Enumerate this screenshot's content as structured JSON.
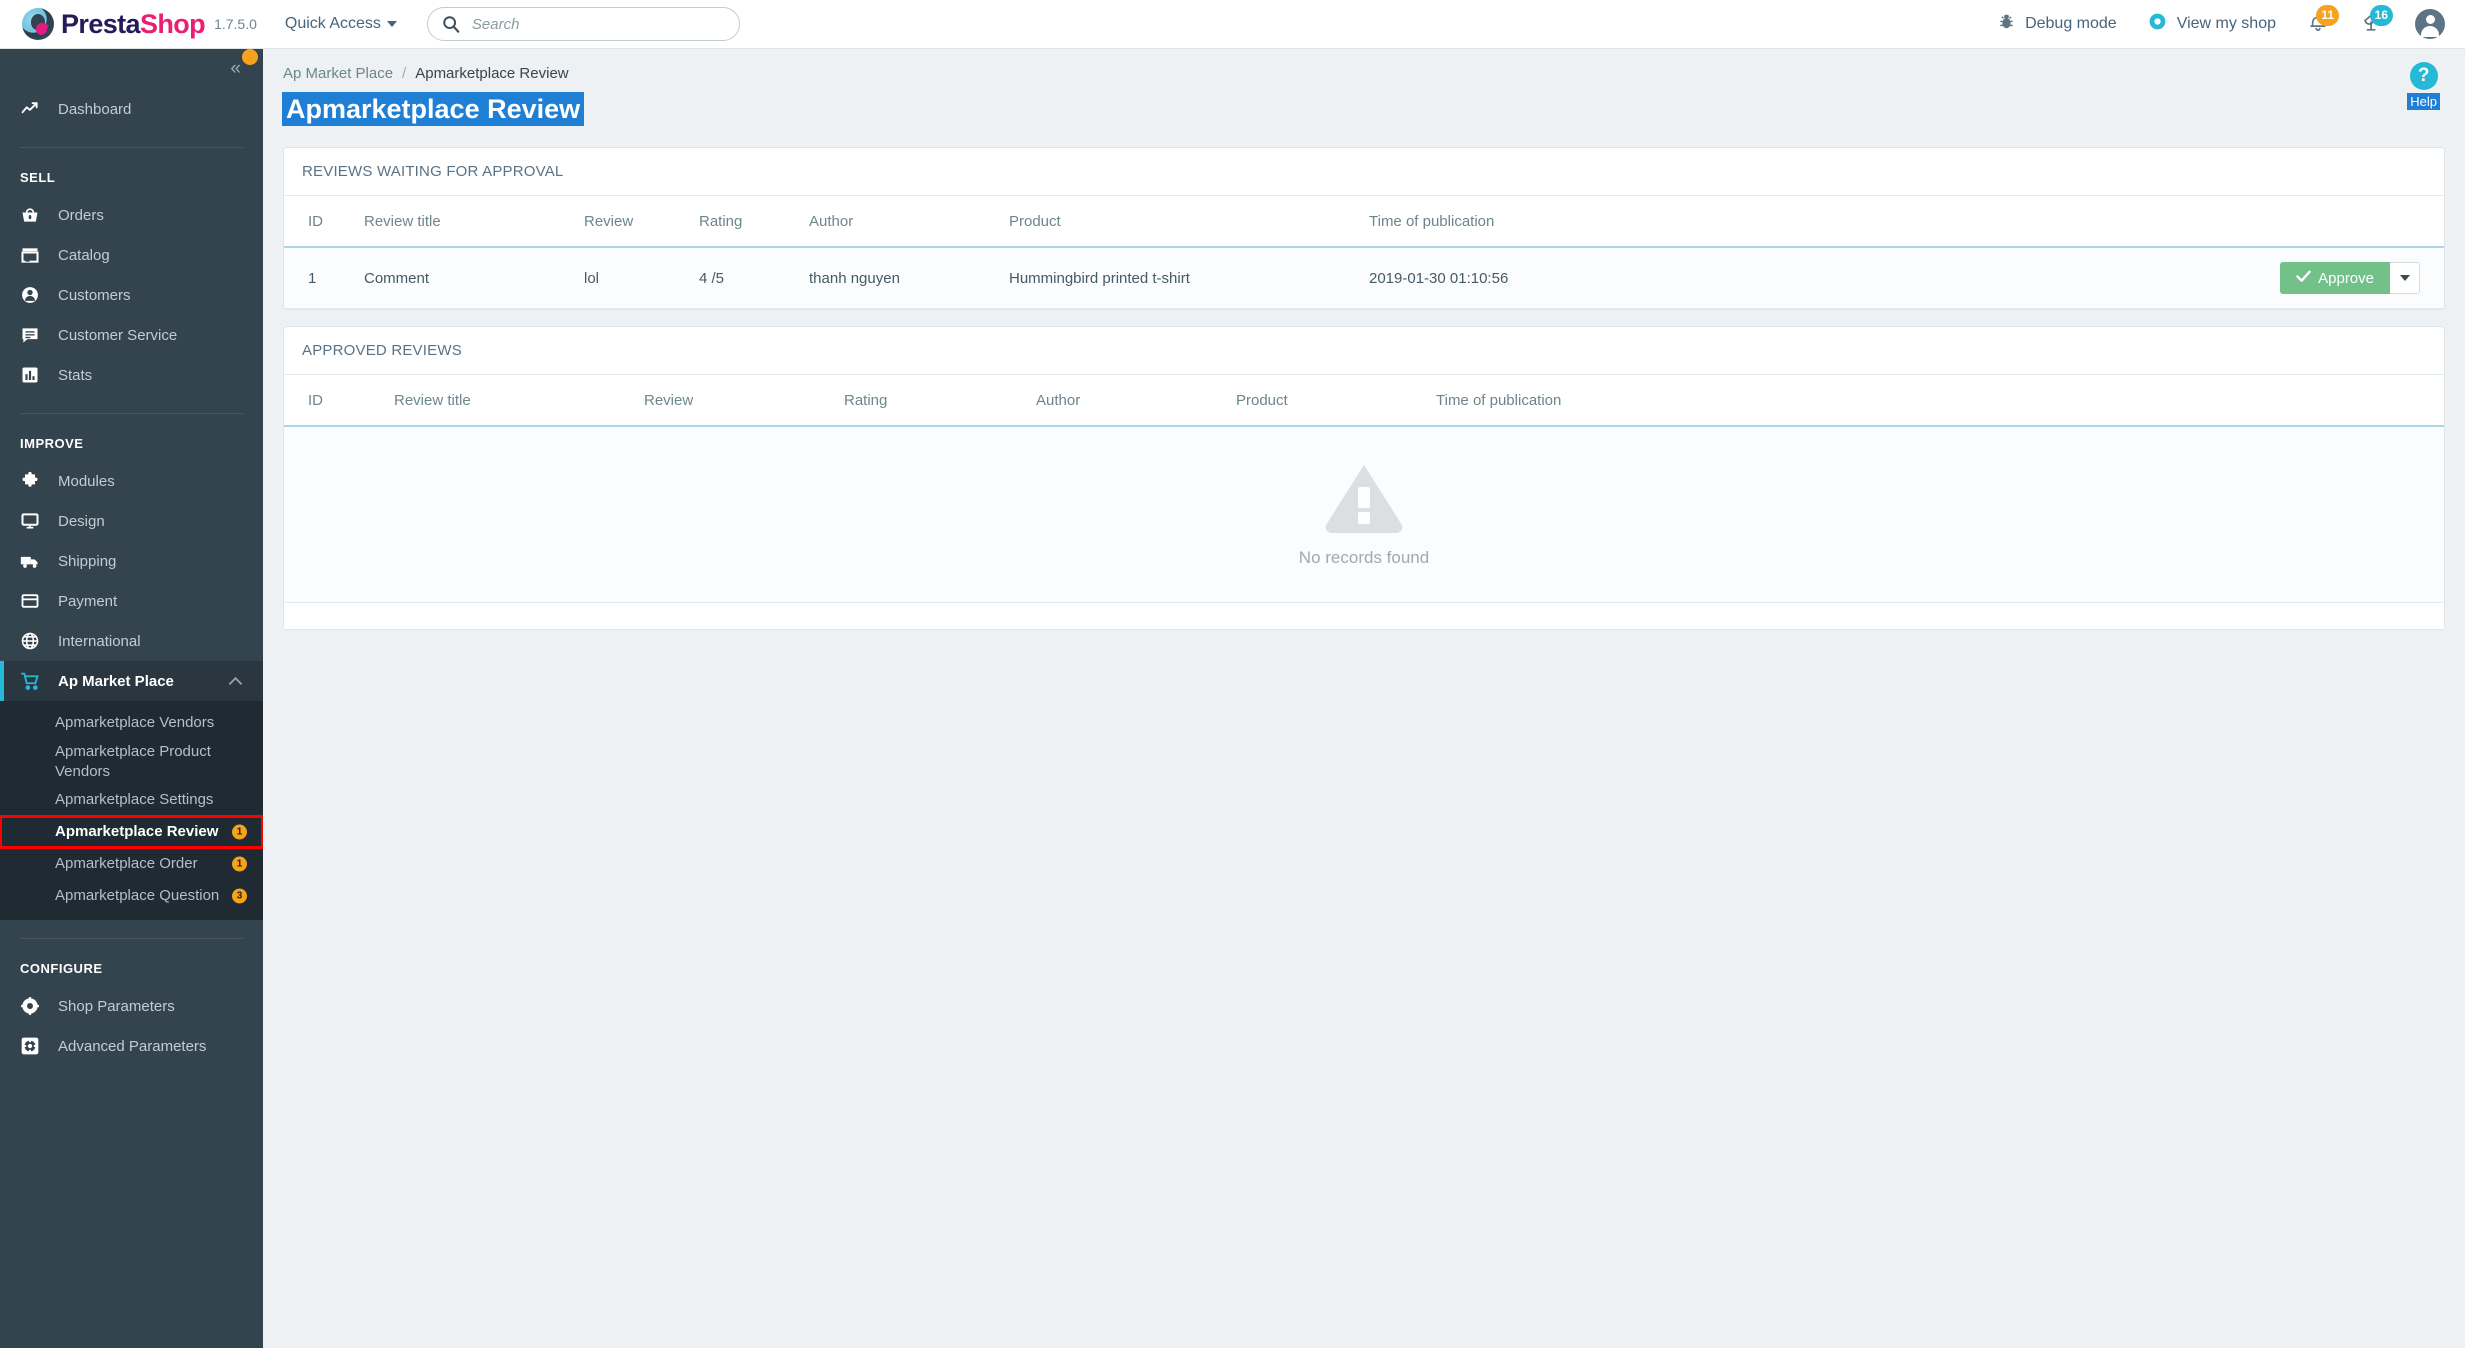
{
  "header": {
    "brand_presta": "Presta",
    "brand_shop": "Shop",
    "version": "1.7.5.0",
    "quick_access": "Quick Access",
    "search_placeholder": "Search",
    "search_value": "",
    "debug_mode": "Debug mode",
    "view_my_shop": "View my shop",
    "notifications_count": "11",
    "messages_count": "16",
    "icons": {
      "search": "search-icon",
      "debug": "bug-icon",
      "shop": "eye-icon",
      "bell": "bell-icon",
      "broadcast": "satellite-icon",
      "avatar": "user-avatar-icon"
    }
  },
  "sidebar": {
    "collapse_label": "«",
    "dashboard": {
      "label": "Dashboard",
      "icon": "trending-up-icon"
    },
    "sections": [
      {
        "heading": "SELL",
        "items": [
          {
            "label": "Orders",
            "icon": "basket-icon"
          },
          {
            "label": "Catalog",
            "icon": "store-icon"
          },
          {
            "label": "Customers",
            "icon": "person-icon"
          },
          {
            "label": "Customer Service",
            "icon": "chat-icon"
          },
          {
            "label": "Stats",
            "icon": "bar-chart-icon"
          }
        ]
      },
      {
        "heading": "IMPROVE",
        "items": [
          {
            "label": "Modules",
            "icon": "puzzle-icon"
          },
          {
            "label": "Design",
            "icon": "monitor-icon"
          },
          {
            "label": "Shipping",
            "icon": "truck-icon"
          },
          {
            "label": "Payment",
            "icon": "credit-card-icon"
          },
          {
            "label": "International",
            "icon": "globe-icon"
          }
        ]
      },
      {
        "heading": "CONFIGURE",
        "items": [
          {
            "label": "Shop Parameters",
            "icon": "gear-icon"
          },
          {
            "label": "Advanced Parameters",
            "icon": "gear-square-icon"
          }
        ]
      }
    ],
    "marketplace": {
      "label": "Ap Market Place",
      "icon": "shopping-cart-icon",
      "expanded": true,
      "chevron": "chevron-up-icon",
      "items": [
        {
          "label": "Apmarketplace Vendors",
          "badge": "",
          "current": false
        },
        {
          "label": "Apmarketplace Product Vendors",
          "badge": "",
          "current": false
        },
        {
          "label": "Apmarketplace Settings",
          "badge": "",
          "current": false
        },
        {
          "label": "Apmarketplace Review",
          "badge": "1",
          "current": true
        },
        {
          "label": "Apmarketplace Order",
          "badge": "1",
          "current": false
        },
        {
          "label": "Apmarketplace Question",
          "badge": "3",
          "current": false
        }
      ]
    }
  },
  "content": {
    "breadcrumb_parent": "Ap Market Place",
    "breadcrumb_sep": "/",
    "breadcrumb_current": "Apmarketplace Review",
    "page_title": "Apmarketplace Review",
    "help_icon": "?",
    "help_label": "Help",
    "waiting_panel": {
      "title": "REVIEWS WAITING FOR APPROVAL",
      "columns": [
        "ID",
        "Review title",
        "Review",
        "Rating",
        "Author",
        "Product",
        "Time of publication",
        ""
      ],
      "rows": [
        {
          "id": "1",
          "review_title": "Comment",
          "review": "lol",
          "rating": "4 /5",
          "author": "thanh nguyen",
          "product": "Hummingbird printed t-shirt",
          "time": "2019-01-30 01:10:56",
          "action_label": "Approve",
          "action_icon": "check-icon"
        }
      ]
    },
    "approved_panel": {
      "title": "APPROVED REVIEWS",
      "columns": [
        "ID",
        "Review title",
        "Review",
        "Rating",
        "Author",
        "Product",
        "Time of publication"
      ],
      "empty_text": "No records found",
      "empty_icon": "warning-triangle-icon"
    }
  },
  "colors": {
    "accent_cyan": "#25b9d7",
    "sidebar_bg": "#33444f",
    "approve_green": "#72c189",
    "badge_orange": "#f6a21d",
    "selection_blue": "#1f7fd4",
    "highlight_red": "#ff0000"
  }
}
